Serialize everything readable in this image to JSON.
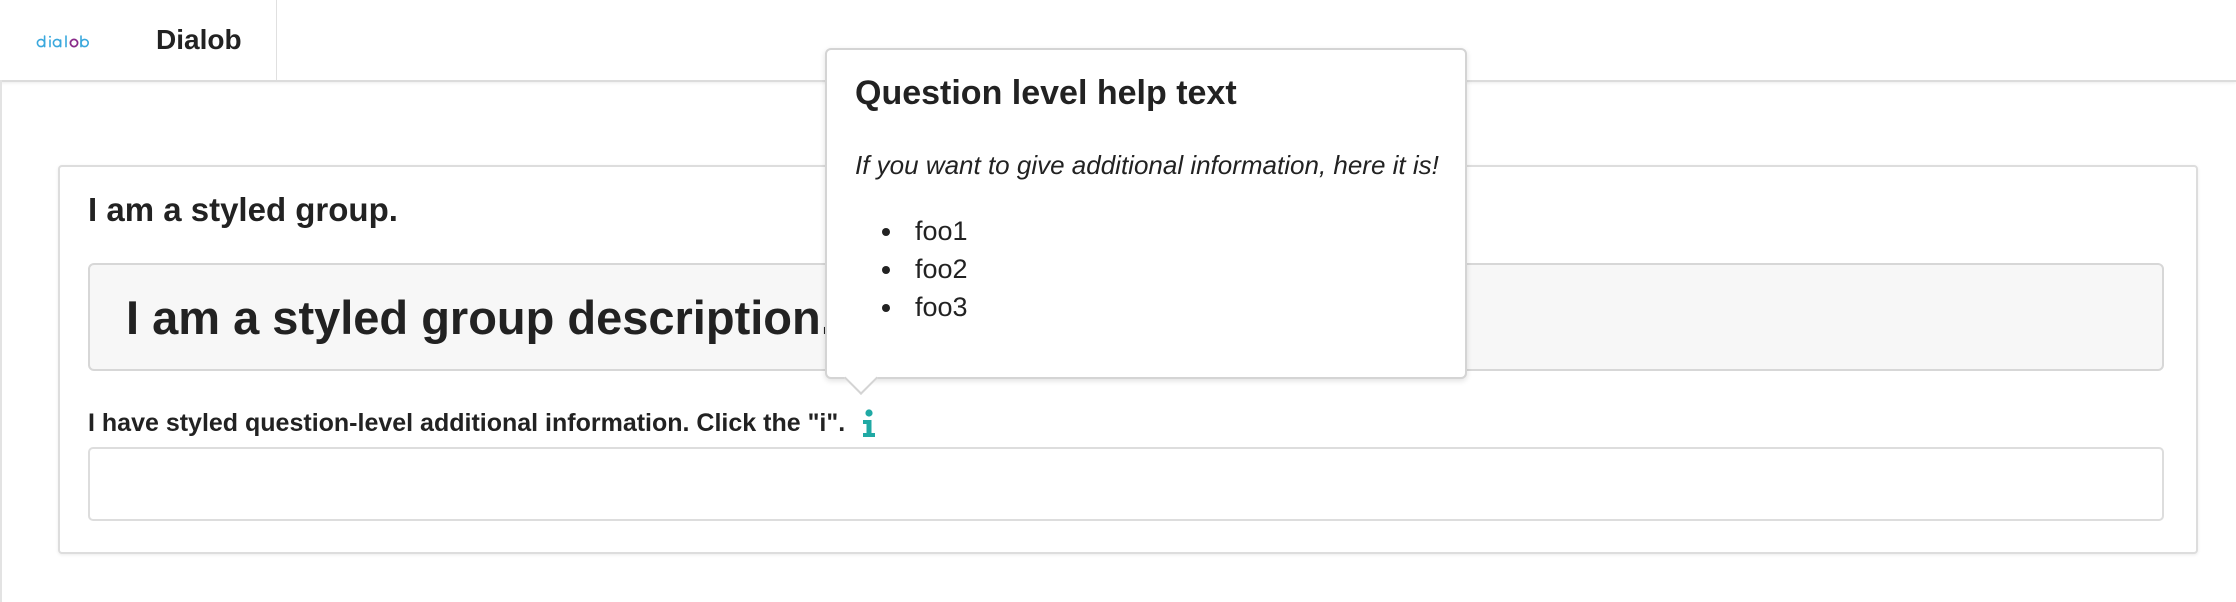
{
  "header": {
    "logo_text": "dialob",
    "app_name": "Dialob"
  },
  "group": {
    "title": "I am a styled group.",
    "description": "I am a styled group description."
  },
  "question": {
    "label": "I have styled question-level additional information. Click the \"i\".",
    "value": "",
    "info_icon": "info-icon"
  },
  "popover": {
    "title": "Question level help text",
    "text": "If you want to give additional information, here it is!",
    "items": [
      "foo1",
      "foo2",
      "foo3"
    ]
  },
  "colors": {
    "accent": "#20a9a4",
    "logo_blue": "#3aa8dd",
    "logo_purple": "#8a2b8a"
  }
}
